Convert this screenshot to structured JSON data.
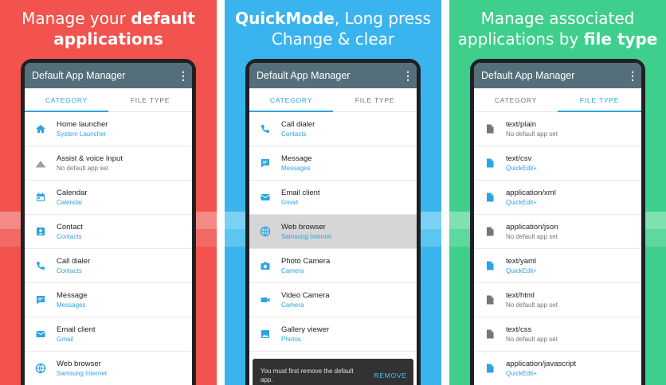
{
  "colors": {
    "red_panel": "#f2534e",
    "blue_panel": "#3ab4ee",
    "green_panel": "#3fcf8c",
    "accent": "#2aa4e2",
    "appbar": "#546e7a"
  },
  "panels": [
    {
      "headline_plain": "Manage your ",
      "headline_bold": "default",
      "headline_line2": "applications",
      "app_title": "Default App Manager",
      "tab_category": "CATEGORY",
      "tab_filetype": "FILE TYPE",
      "rows": [
        {
          "icon": "home-icon",
          "title": "Home launcher",
          "sub": "System Launcher",
          "muted": false
        },
        {
          "icon": "assistant-icon",
          "title": "Assist & voice Input",
          "sub": "No default app set",
          "muted": true
        },
        {
          "icon": "calendar-icon",
          "title": "Calendar",
          "sub": "Calendar",
          "muted": false
        },
        {
          "icon": "contact-icon",
          "title": "Contact",
          "sub": "Contacts",
          "muted": false
        },
        {
          "icon": "phone-icon",
          "title": "Call dialer",
          "sub": "Contacts",
          "muted": false
        },
        {
          "icon": "message-icon",
          "title": "Message",
          "sub": "Messages",
          "muted": false
        },
        {
          "icon": "email-icon",
          "title": "Email client",
          "sub": "Gmail",
          "muted": false
        },
        {
          "icon": "browser-icon",
          "title": "Web browser",
          "sub": "Samsung Internet",
          "muted": false
        }
      ]
    },
    {
      "headline_bold": "QuickMode",
      "headline_plain": ", Long press",
      "headline_line2": "Change & clear",
      "app_title": "Default App Manager",
      "tab_category": "CATEGORY",
      "tab_filetype": "FILE TYPE",
      "rows": [
        {
          "icon": "phone-icon",
          "title": "Call dialer",
          "sub": "Contacts",
          "muted": false
        },
        {
          "icon": "message-icon",
          "title": "Message",
          "sub": "Messages",
          "muted": false
        },
        {
          "icon": "email-icon",
          "title": "Email client",
          "sub": "Gmail",
          "muted": false
        },
        {
          "icon": "browser-icon",
          "title": "Web browser",
          "sub": "Samsung Internet",
          "muted": false,
          "selected": true
        },
        {
          "icon": "camera-icon",
          "title": "Photo Camera",
          "sub": "Camera",
          "muted": false
        },
        {
          "icon": "video-icon",
          "title": "Video Camera",
          "sub": "Camera",
          "muted": false
        },
        {
          "icon": "gallery-icon",
          "title": "Gallery viewer",
          "sub": "Photos",
          "muted": false
        }
      ],
      "snackbar": {
        "message": "You must first remove the default app.",
        "action": "REMOVE"
      }
    },
    {
      "headline_line1": "Manage associated",
      "headline_plain": "applications by ",
      "headline_bold": "file type",
      "app_title": "Default App Manager",
      "tab_category": "CATEGORY",
      "tab_filetype": "FILE TYPE",
      "rows": [
        {
          "icon": "file-icon",
          "title": "text/plain",
          "sub": "No default app set",
          "muted": true
        },
        {
          "icon": "file-icon",
          "title": "text/csv",
          "sub": "QuickEdit+",
          "muted": false
        },
        {
          "icon": "file-icon",
          "title": "application/xml",
          "sub": "QuickEdit+",
          "muted": false
        },
        {
          "icon": "file-icon",
          "title": "application/json",
          "sub": "No default app set",
          "muted": true
        },
        {
          "icon": "file-icon",
          "title": "text/yaml",
          "sub": "QuickEdit+",
          "muted": false
        },
        {
          "icon": "file-icon",
          "title": "text/html",
          "sub": "No default app set",
          "muted": true
        },
        {
          "icon": "file-icon",
          "title": "text/css",
          "sub": "No default app set",
          "muted": true
        },
        {
          "icon": "file-icon",
          "title": "application/javascript",
          "sub": "QuickEdit+",
          "muted": false
        }
      ]
    }
  ]
}
